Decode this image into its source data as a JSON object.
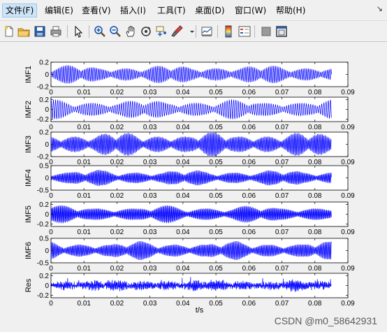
{
  "menu": {
    "items": [
      "文件(F)",
      "编辑(E)",
      "查看(V)",
      "插入(I)",
      "工具(T)",
      "桌面(D)",
      "窗口(W)",
      "帮助(H)"
    ],
    "more_icon": "dock-arrow-icon"
  },
  "toolbar": {
    "icons": [
      "new-file-icon",
      "open-folder-icon",
      "save-icon",
      "print-icon",
      "pointer-icon",
      "zoom-in-icon",
      "zoom-out-icon",
      "pan-hand-icon",
      "rotate-3d-icon",
      "data-cursor-icon",
      "brush-icon",
      "link-plot-icon",
      "colorbar-icon",
      "legend-icon",
      "hide-plot-tools-icon",
      "show-plot-tools-icon"
    ]
  },
  "colors": {
    "signal": "#0000ff",
    "axes": "#000000",
    "background": "#ffffff"
  },
  "chart_data": {
    "type": "line",
    "xlabel": "t/s",
    "xlim": [
      0,
      0.09
    ],
    "xticks": [
      "0",
      "0.01",
      "0.02",
      "0.03",
      "0.04",
      "0.05",
      "0.06",
      "0.07",
      "0.08",
      "0.09"
    ],
    "signal_end": 0.085,
    "panels": [
      {
        "ylabel": "IMF1",
        "ylim": [
          -0.2,
          0.2
        ],
        "yticks": [
          "0.2",
          "0",
          "-0.2"
        ],
        "amp": 0.1,
        "freq": 1900,
        "env_freq": 110
      },
      {
        "ylabel": "IMF2",
        "ylim": [
          -0.25,
          0.25
        ],
        "yticks": [
          "0.2",
          "0",
          "-0.2"
        ],
        "amp": 0.13,
        "freq": 1500,
        "env_freq": 95
      },
      {
        "ylabel": "IMF3",
        "ylim": [
          -0.2,
          0.2
        ],
        "yticks": [
          "0.2",
          "0",
          "-0.2"
        ],
        "amp": 0.13,
        "freq": 2600,
        "env_freq": 120
      },
      {
        "ylabel": "IMF4",
        "ylim": [
          -0.5,
          0.5
        ],
        "yticks": [
          "0.5",
          "0",
          "-0.5"
        ],
        "amp": 0.22,
        "freq": 2800,
        "env_freq": 100
      },
      {
        "ylabel": "IMF5",
        "ylim": [
          -0.25,
          0.25
        ],
        "yticks": [
          "0.2",
          "0",
          "-0.2"
        ],
        "amp": 0.12,
        "freq": 3000,
        "env_freq": 90
      },
      {
        "ylabel": "IMF6",
        "ylim": [
          -0.5,
          0.5
        ],
        "yticks": [
          "0.5",
          "0",
          "-0.5"
        ],
        "amp": 0.25,
        "freq": 2700,
        "env_freq": 105
      },
      {
        "ylabel": "Res",
        "ylim": [
          -0.25,
          0.25
        ],
        "yticks": [
          "0.2",
          "0",
          "-0.2"
        ],
        "amp": 0.06,
        "freq": 3200,
        "env_freq": 130
      }
    ]
  },
  "watermark": "CSDN @m0_58642931"
}
